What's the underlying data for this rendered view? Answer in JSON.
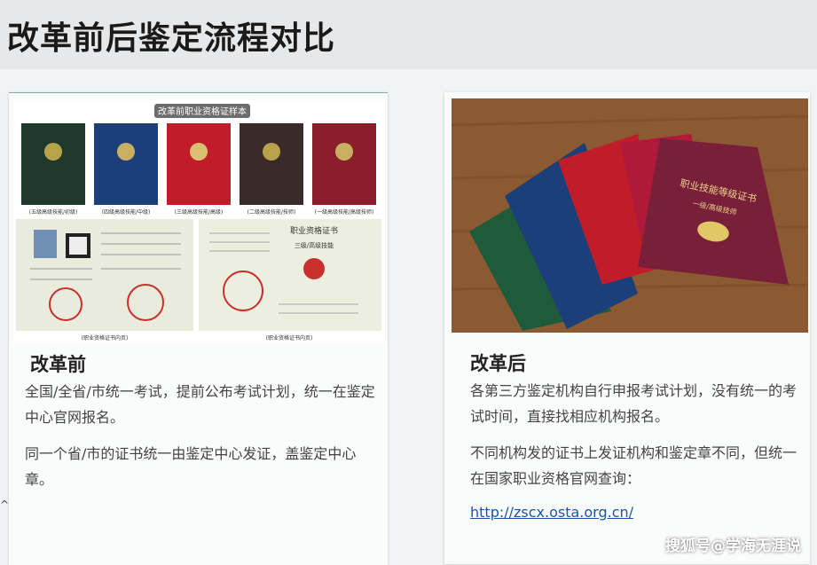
{
  "header": {
    "title": "改革前后鉴定流程对比"
  },
  "left": {
    "image_caption": "改革前职业资格证样本",
    "cert_labels": [
      "(五级高级技能/初级)",
      "(四级高级技能/中级)",
      "(三级高级技能/高级)",
      "(二级高级技能/技师)",
      "(一级高级技能/高级技师)"
    ],
    "cert_inner_title": "职业资格证书",
    "cert_inner_level": "三级/高级技能",
    "page_label_1": "(职业资格证书内页)",
    "page_label_2": "(职业资格证书内页)",
    "heading": "改革前",
    "para1": "全国/全省/市统一考试，提前公布考试计划，统一在鉴定中心官网报名。",
    "para2": "同一个省/市的证书统一由鉴定中心发证，盖鉴定中心章。"
  },
  "right": {
    "cert_cover_title": "职业技能等级证书",
    "cert_cover_sub": "一级/高级技师",
    "heading": "改革后",
    "para1": "各第三方鉴定机构自行申报考试计划，没有统一的考试时间，直接找相应机构报名。",
    "para2": "不同机构发的证书上发证机构和鉴定章不同，但统一在国家职业资格官网查询：",
    "link": "http://zscx.osta.org.cn/"
  },
  "watermark": "搜狐号@学海无涯说",
  "colors": {
    "green": "#1f5a3a",
    "navy": "#1c3f7a",
    "red": "#c21c2b",
    "dark": "#3a2a2a",
    "maroon": "#7a1f3a",
    "wood": "#8c5a32"
  }
}
